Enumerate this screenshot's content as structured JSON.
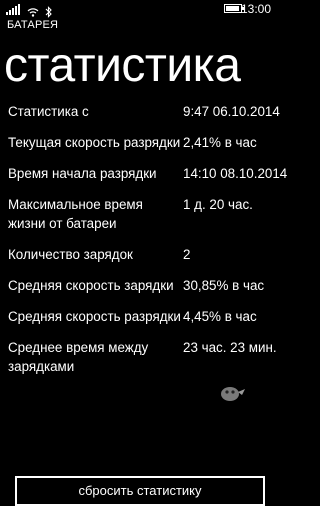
{
  "status_bar": {
    "time": "13:00",
    "icons": [
      "signal-icon",
      "wifi-icon",
      "bluetooth-icon",
      "battery-icon"
    ],
    "battery_level": 0.9
  },
  "app": {
    "title": "БАТАРЕЯ"
  },
  "page": {
    "title": "статистика"
  },
  "stats": [
    {
      "label": "Статистика с",
      "value": "9:47 06.10.2014"
    },
    {
      "label": "Текущая скорость разрядки",
      "value": "2,41% в час"
    },
    {
      "label": "Время начала разрядки",
      "value": "14:10 08.10.2014"
    },
    {
      "label": "Максимальное время жизни от батареи",
      "value": "1 д. 20 час."
    },
    {
      "label": "Количество зарядок",
      "value": "2"
    },
    {
      "label": "Средняя скорость зарядки",
      "value": "30,85% в час"
    },
    {
      "label": "Средняя скорость разрядки",
      "value": "4,45% в час"
    },
    {
      "label": "Среднее время между зарядками",
      "value": "23 час. 23 мин."
    }
  ],
  "actions": {
    "reset_label": "сбросить статистику"
  },
  "colors": {
    "background": "#000000",
    "text": "#ffffff"
  }
}
